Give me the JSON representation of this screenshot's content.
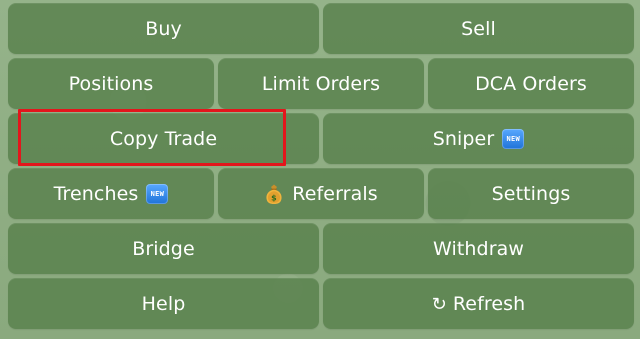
{
  "keyboard": {
    "rows": [
      [
        {
          "label": "Buy"
        },
        {
          "label": "Sell"
        }
      ],
      [
        {
          "label": "Positions"
        },
        {
          "label": "Limit Orders"
        },
        {
          "label": "DCA Orders"
        }
      ],
      [
        {
          "label": "Copy Trade"
        },
        {
          "label": "Sniper",
          "badge": "NEW"
        }
      ],
      [
        {
          "label": "Trenches",
          "badge": "NEW"
        },
        {
          "label": "Referrals",
          "icon": "money-bag-icon"
        },
        {
          "label": "Settings"
        }
      ],
      [
        {
          "label": "Bridge"
        },
        {
          "label": "Withdraw"
        }
      ],
      [
        {
          "label": "Help"
        },
        {
          "label": "Refresh",
          "icon": "refresh-icon",
          "icon_glyph": "↻"
        }
      ]
    ]
  },
  "highlight": {
    "target": "Copy Trade",
    "color": "#e3161c"
  },
  "colors": {
    "button_bg": "#58804c",
    "text": "#ffffff",
    "background": "#8fae83",
    "badge_blue": "#1f73d8"
  }
}
